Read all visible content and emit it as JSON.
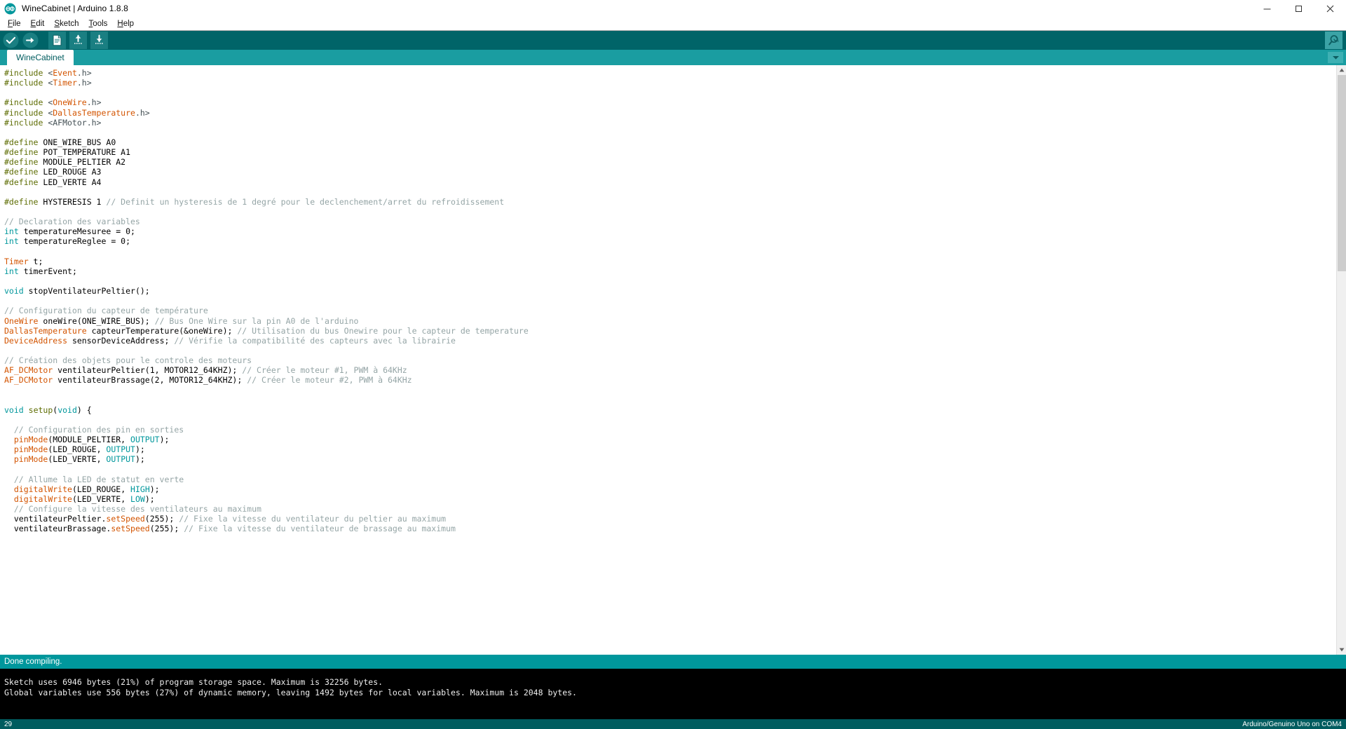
{
  "window": {
    "title": "WineCabinet | Arduino 1.8.8",
    "logo_icon": "arduino-logo-icon",
    "minimize_icon": "minimize-icon",
    "maximize_icon": "maximize-icon",
    "close_icon": "close-icon"
  },
  "menubar": {
    "items": [
      {
        "label": "File",
        "mnemonic": "F",
        "rest": "ile"
      },
      {
        "label": "Edit",
        "mnemonic": "E",
        "rest": "dit"
      },
      {
        "label": "Sketch",
        "mnemonic": "S",
        "rest": "ketch"
      },
      {
        "label": "Tools",
        "mnemonic": "T",
        "rest": "ools"
      },
      {
        "label": "Help",
        "mnemonic": "H",
        "rest": "elp"
      }
    ]
  },
  "toolbar": {
    "verify_icon": "check-verify-icon",
    "upload_icon": "arrow-right-upload-icon",
    "new_icon": "new-sketch-icon",
    "open_icon": "open-sketch-icon",
    "save_icon": "save-sketch-icon",
    "serial_monitor_icon": "serial-monitor-magnifier-icon"
  },
  "tabs": {
    "active": "WineCabinet",
    "items": [
      "WineCabinet"
    ],
    "menu_icon": "chevron-down-icon"
  },
  "editor": {
    "scrollbar": {
      "up_icon": "scroll-up-icon",
      "down_icon": "scroll-down-icon"
    },
    "lines": [
      [
        {
          "t": "#include ",
          "c": "c-pre"
        },
        {
          "t": "<",
          "c": "c-op"
        },
        {
          "t": "Event",
          "c": "c-lib"
        },
        {
          "t": ".h>",
          "c": "c-op"
        }
      ],
      [
        {
          "t": "#include ",
          "c": "c-pre"
        },
        {
          "t": "<",
          "c": "c-op"
        },
        {
          "t": "Timer",
          "c": "c-lib"
        },
        {
          "t": ".h>",
          "c": "c-op"
        }
      ],
      [],
      [
        {
          "t": "#include ",
          "c": "c-pre"
        },
        {
          "t": "<",
          "c": "c-op"
        },
        {
          "t": "OneWire",
          "c": "c-lib"
        },
        {
          "t": ".h>",
          "c": "c-op"
        }
      ],
      [
        {
          "t": "#include ",
          "c": "c-pre"
        },
        {
          "t": "<",
          "c": "c-op"
        },
        {
          "t": "DallasTemperature",
          "c": "c-lib"
        },
        {
          "t": ".h>",
          "c": "c-op"
        }
      ],
      [
        {
          "t": "#include ",
          "c": "c-pre"
        },
        {
          "t": "<AFMotor.h>",
          "c": "c-op"
        }
      ],
      [],
      [
        {
          "t": "#define ",
          "c": "c-pre"
        },
        {
          "t": "ONE_WIRE_BUS A0",
          "c": "c-txt"
        }
      ],
      [
        {
          "t": "#define ",
          "c": "c-pre"
        },
        {
          "t": "POT_TEMPERATURE A1",
          "c": "c-txt"
        }
      ],
      [
        {
          "t": "#define ",
          "c": "c-pre"
        },
        {
          "t": "MODULE_PELTIER A2",
          "c": "c-txt"
        }
      ],
      [
        {
          "t": "#define ",
          "c": "c-pre"
        },
        {
          "t": "LED_ROUGE A3",
          "c": "c-txt"
        }
      ],
      [
        {
          "t": "#define ",
          "c": "c-pre"
        },
        {
          "t": "LED_VERTE A4",
          "c": "c-txt"
        }
      ],
      [],
      [
        {
          "t": "#define ",
          "c": "c-pre"
        },
        {
          "t": "HYSTERESIS 1 ",
          "c": "c-txt"
        },
        {
          "t": "// Definit un hysteresis de 1 degré pour le declenchement/arret du refroidissement",
          "c": "c-cmt"
        }
      ],
      [],
      [
        {
          "t": "// Declaration des variables",
          "c": "c-cmt"
        }
      ],
      [
        {
          "t": "int",
          "c": "c-kw"
        },
        {
          "t": " temperatureMesuree = 0;",
          "c": "c-txt"
        }
      ],
      [
        {
          "t": "int",
          "c": "c-kw"
        },
        {
          "t": " temperatureReglee = 0;",
          "c": "c-txt"
        }
      ],
      [],
      [
        {
          "t": "Timer",
          "c": "c-lib"
        },
        {
          "t": " t;",
          "c": "c-txt"
        }
      ],
      [
        {
          "t": "int",
          "c": "c-kw"
        },
        {
          "t": " timerEvent;",
          "c": "c-txt"
        }
      ],
      [],
      [
        {
          "t": "void",
          "c": "c-kw"
        },
        {
          "t": " stopVentilateurPeltier();",
          "c": "c-txt"
        }
      ],
      [],
      [
        {
          "t": "// Configuration du capteur de température",
          "c": "c-cmt"
        }
      ],
      [
        {
          "t": "OneWire",
          "c": "c-lib"
        },
        {
          "t": " oneWire(ONE_WIRE_BUS); ",
          "c": "c-txt"
        },
        {
          "t": "// Bus One Wire sur la pin A0 de l'arduino",
          "c": "c-cmt"
        }
      ],
      [
        {
          "t": "DallasTemperature",
          "c": "c-lib"
        },
        {
          "t": " capteurTemperature(&oneWire); ",
          "c": "c-txt"
        },
        {
          "t": "// Utilisation du bus Onewire pour le capteur de temperature",
          "c": "c-cmt"
        }
      ],
      [
        {
          "t": "DeviceAddress",
          "c": "c-lib"
        },
        {
          "t": " sensorDeviceAddress; ",
          "c": "c-txt"
        },
        {
          "t": "// Vérifie la compatibilité des capteurs avec la librairie",
          "c": "c-cmt"
        }
      ],
      [],
      [
        {
          "t": "// Création des objets pour le controle des moteurs",
          "c": "c-cmt"
        }
      ],
      [
        {
          "t": "AF_DCMotor",
          "c": "c-lib"
        },
        {
          "t": " ventilateurPeltier(1, MOTOR12_64KHZ); ",
          "c": "c-txt"
        },
        {
          "t": "// Créer le moteur #1, PWM à 64KHz",
          "c": "c-cmt"
        }
      ],
      [
        {
          "t": "AF_DCMotor",
          "c": "c-lib"
        },
        {
          "t": " ventilateurBrassage(2, MOTOR12_64KHZ); ",
          "c": "c-txt"
        },
        {
          "t": "// Créer le moteur #2, PWM à 64KHz",
          "c": "c-cmt"
        }
      ],
      [],
      [],
      [
        {
          "t": "void",
          "c": "c-kw"
        },
        {
          "t": " ",
          "c": "c-txt"
        },
        {
          "t": "setup",
          "c": "c-fn2"
        },
        {
          "t": "(",
          "c": "c-txt"
        },
        {
          "t": "void",
          "c": "c-kw"
        },
        {
          "t": ") {",
          "c": "c-txt"
        }
      ],
      [],
      [
        {
          "t": "  // Configuration des pin en sorties",
          "c": "c-cmt"
        }
      ],
      [
        {
          "t": "  ",
          "c": "c-txt"
        },
        {
          "t": "pinMode",
          "c": "c-fn"
        },
        {
          "t": "(MODULE_PELTIER, ",
          "c": "c-txt"
        },
        {
          "t": "OUTPUT",
          "c": "c-kw"
        },
        {
          "t": ");",
          "c": "c-txt"
        }
      ],
      [
        {
          "t": "  ",
          "c": "c-txt"
        },
        {
          "t": "pinMode",
          "c": "c-fn"
        },
        {
          "t": "(LED_ROUGE, ",
          "c": "c-txt"
        },
        {
          "t": "OUTPUT",
          "c": "c-kw"
        },
        {
          "t": ");",
          "c": "c-txt"
        }
      ],
      [
        {
          "t": "  ",
          "c": "c-txt"
        },
        {
          "t": "pinMode",
          "c": "c-fn"
        },
        {
          "t": "(LED_VERTE, ",
          "c": "c-txt"
        },
        {
          "t": "OUTPUT",
          "c": "c-kw"
        },
        {
          "t": ");",
          "c": "c-txt"
        }
      ],
      [],
      [
        {
          "t": "  // Allume la LED de statut en verte",
          "c": "c-cmt"
        }
      ],
      [
        {
          "t": "  ",
          "c": "c-txt"
        },
        {
          "t": "digitalWrite",
          "c": "c-fn"
        },
        {
          "t": "(LED_ROUGE, ",
          "c": "c-txt"
        },
        {
          "t": "HIGH",
          "c": "c-kw"
        },
        {
          "t": ");",
          "c": "c-txt"
        }
      ],
      [
        {
          "t": "  ",
          "c": "c-txt"
        },
        {
          "t": "digitalWrite",
          "c": "c-fn"
        },
        {
          "t": "(LED_VERTE, ",
          "c": "c-txt"
        },
        {
          "t": "LOW",
          "c": "c-kw"
        },
        {
          "t": ");",
          "c": "c-txt"
        }
      ],
      [
        {
          "t": "  // Configure la vitesse des ventilateurs au maximum",
          "c": "c-cmt"
        }
      ],
      [
        {
          "t": "  ventilateurPeltier.",
          "c": "c-txt"
        },
        {
          "t": "setSpeed",
          "c": "c-fn"
        },
        {
          "t": "(255); ",
          "c": "c-txt"
        },
        {
          "t": "// Fixe la vitesse du ventilateur du peltier au maximum",
          "c": "c-cmt"
        }
      ],
      [
        {
          "t": "  ventilateurBrassage.",
          "c": "c-txt"
        },
        {
          "t": "setSpeed",
          "c": "c-fn"
        },
        {
          "t": "(255); ",
          "c": "c-txt"
        },
        {
          "t": "// Fixe la vitesse du ventilateur de brassage au maximum",
          "c": "c-cmt"
        }
      ]
    ]
  },
  "status": {
    "message": "Done compiling."
  },
  "console": {
    "lines": [
      "Sketch uses 6946 bytes (21%) of program storage space. Maximum is 32256 bytes.",
      "Global variables use 556 bytes (27%) of dynamic memory, leaving 1492 bytes for local variables. Maximum is 2048 bytes."
    ]
  },
  "bottombar": {
    "line_number": "29",
    "board_info": "Arduino/Genuino Uno on COM4"
  },
  "colors": {
    "toolbar_bg": "#006468",
    "tabstrip_bg": "#1a9da1",
    "status_bg": "#00979c",
    "console_bg": "#000000",
    "bottombar_bg": "#005c5f",
    "accent": "#00979c"
  }
}
